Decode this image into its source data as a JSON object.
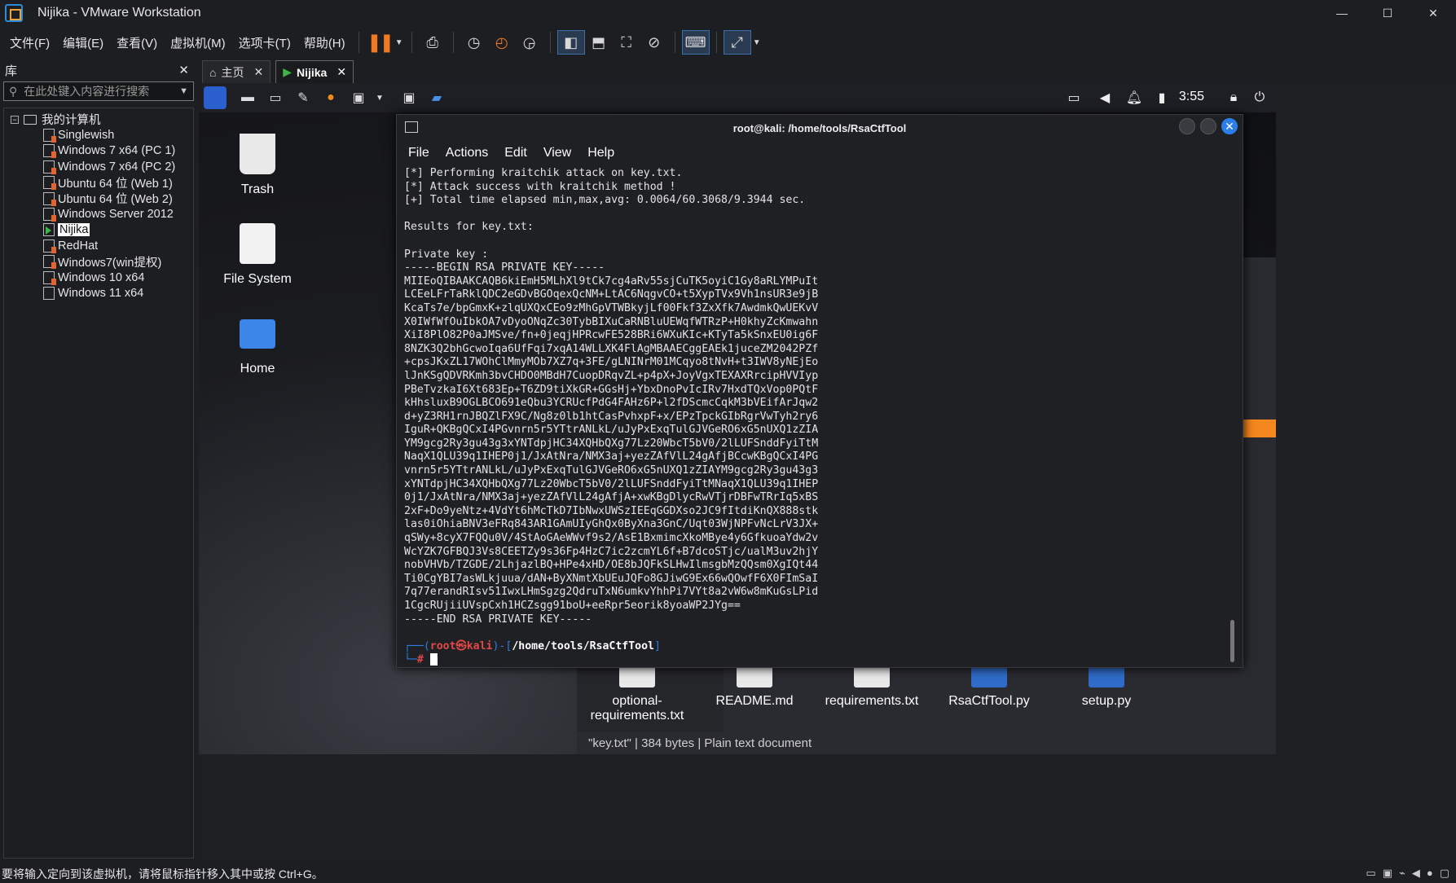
{
  "window": {
    "title": "Nijika - VMware Workstation"
  },
  "menu": [
    "文件(F)",
    "编辑(E)",
    "查看(V)",
    "虚拟机(M)",
    "选项卡(T)",
    "帮助(H)"
  ],
  "library": {
    "header": "库",
    "search_placeholder": "在此处键入内容进行搜索",
    "root": "我的计算机",
    "vms": [
      {
        "label": "Singlewish",
        "state": "warn"
      },
      {
        "label": "Windows 7 x64 (PC 1)",
        "state": "warn"
      },
      {
        "label": "Windows 7 x64 (PC 2)",
        "state": "warn"
      },
      {
        "label": "Ubuntu 64 位 (Web 1)",
        "state": "warn"
      },
      {
        "label": "Ubuntu 64 位 (Web 2)",
        "state": "warn"
      },
      {
        "label": "Windows Server 2012",
        "state": "warn"
      },
      {
        "label": "Nijika",
        "state": "on"
      },
      {
        "label": "RedHat",
        "state": "warn"
      },
      {
        "label": "Windows7(win提权)",
        "state": "warn"
      },
      {
        "label": "Windows 10 x64",
        "state": "warn"
      },
      {
        "label": "Windows 11 x64",
        "state": "off"
      }
    ]
  },
  "tabs": [
    {
      "label": "主页"
    },
    {
      "label": "Nijika"
    }
  ],
  "guest": {
    "clock": "3:55",
    "desktop": {
      "trash": "Trash",
      "filesystem": "File System",
      "home": "Home"
    },
    "file_manager": {
      "files": [
        "optional-requirements.txt",
        "README.md",
        "requirements.txt",
        "RsaCtfTool.py",
        "setup.py"
      ],
      "status": "\"key.txt\" | 384 bytes | Plain text document"
    },
    "terminal": {
      "title": "root@kali: /home/tools/RsaCtfTool",
      "menu": [
        "File",
        "Actions",
        "Edit",
        "View",
        "Help"
      ],
      "lines": [
        "[*] Performing kraitchik attack on key.txt.",
        "[*] Attack success with kraitchik method !",
        "[+] Total time elapsed min,max,avg: 0.0064/60.3068/9.3944 sec.",
        "",
        "Results for key.txt:",
        "",
        "Private key :",
        "-----BEGIN RSA PRIVATE KEY-----",
        "MIIEoQIBAAKCAQB6kiEmH5MLhXl9tCk7cg4aRv55sjCuTK5oyiC1Gy8aRLYMPuIt",
        "LCEeLFrTaRklQDC2eGDvBGOqexQcNM+LtAC6NqgvCO+t5XypTVx9Vh1nsUR3e9jB",
        "KcaTs7e/bpGmxK+zlqUXQxCEo9zMhGpVTWBkyjLf00Fkf3ZxXfk7AwdmkQwUEKvV",
        "X0IWfWfOuIbkOA7vDyoONqZc30TybBIXuCaRNBluUEWqfWTRzP+H0khyZcKmwahn",
        "XiI8PlO82P0aJMSve/fn+0jeqjHPRcwFE528BRi6WXuKIc+KTyTa5kSnxEU0ig6F",
        "8NZK3Q2bhGcwoIqa6UfFqi7xqA14WLLXK4FlAgMBAAECggEAEk1juceZM2042PZf",
        "+cpsJKxZL17WOhClMmyMOb7XZ7q+3FE/gLNINrM01MCqyo8tNvH+t3IWV8yNEjEo",
        "lJnKSgQDVRKmh3bvCHDO0MBdH7CuopDRqvZL+p4pX+JoyVgxTEXAXRrcipHVVIyp",
        "PBeTvzkaI6Xt683Ep+T6ZD9tiXkGR+GGsHj+YbxDnoPvIcIRv7HxdTQxVop0PQtF",
        "kHhsluxB9OGLBCO691eQbu3YCRUcfPdG4FAHz6P+l2fDScmcCqkM3bVEifArJqw2",
        "d+yZ3RH1rnJBQZlFX9C/Ng8z0lb1htCasPvhxpF+x/EPzTpckGIbRgrVwTyh2ry6",
        "IguR+QKBgQCxI4PGvnrn5r5YTtrANLkL/uJyPxExqTulGJVGeRO6xG5nUXQ1zZIA",
        "YM9gcg2Ry3gu43g3xYNTdpjHC34XQHbQXg77Lz20WbcT5bV0/2lLUFSnddFyiTtM",
        "NaqX1QLU39q1IHEP0j1/JxAtNra/NMX3aj+yezZAfVlL24gAfjBCcwKBgQCxI4PG",
        "vnrn5r5YTtrANLkL/uJyPxExqTulGJVGeRO6xG5nUXQ1zZIAYM9gcg2Ry3gu43g3",
        "xYNTdpjHC34XQHbQXg77Lz20WbcT5bV0/2lLUFSnddFyiTtMNaqX1QLU39q1IHEP",
        "0j1/JxAtNra/NMX3aj+yezZAfVlL24gAfjA+xwKBgDlycRwVTjrDBFwTRrIq5xBS",
        "2xF+Do9yeNtz+4VdYt6hMcTkD7IbNwxUWSzIEEqGGDXso2JC9fItdiKnQX888stk",
        "las0iOhiaBNV3eFRq843AR1GAmUIyGhQx0ByXna3GnC/Uqt03WjNPFvNcLrV3JX+",
        "qSWy+8cyX7FQQu0V/4StAoGAeWWvf9s2/AsE1BxmimcXkoMBye4y6GfkuoaYdw2v",
        "WcYZK7GFBQJ3Vs8CEETZy9s36Fp4HzC7ic2zcmYL6f+B7dcoSTjc/ualM3uv2hjY",
        "nobVHVb/TZGDE/2LhjazlBQ+HPe4xHD/OE8bJQFkSLHwIlmsgbMzQQsm0XgIQt44",
        "Ti0CgYBI7asWLkjuua/dAN+ByXNmtXbUEuJQFo8GJiwG9Ex66wQOwfF6X0FImSaI",
        "7q77erandRIsv51IwxLHmSgzg2QdruTxN6umkvYhhPi7VYt8a2vW6w8mKuGsLPid",
        "1CgcRUjiiUVspCxh1HCZsgg91boU+eeRpr5eorik8yoaWP2JYg==",
        "-----END RSA PRIVATE KEY-----",
        ""
      ],
      "prompt_user": "root㉿kali",
      "prompt_path": "/home/tools/RsaCtfTool"
    }
  },
  "statusbar": {
    "text": "要将输入定向到该虚拟机，请将鼠标指针移入其中或按 Ctrl+G。"
  }
}
